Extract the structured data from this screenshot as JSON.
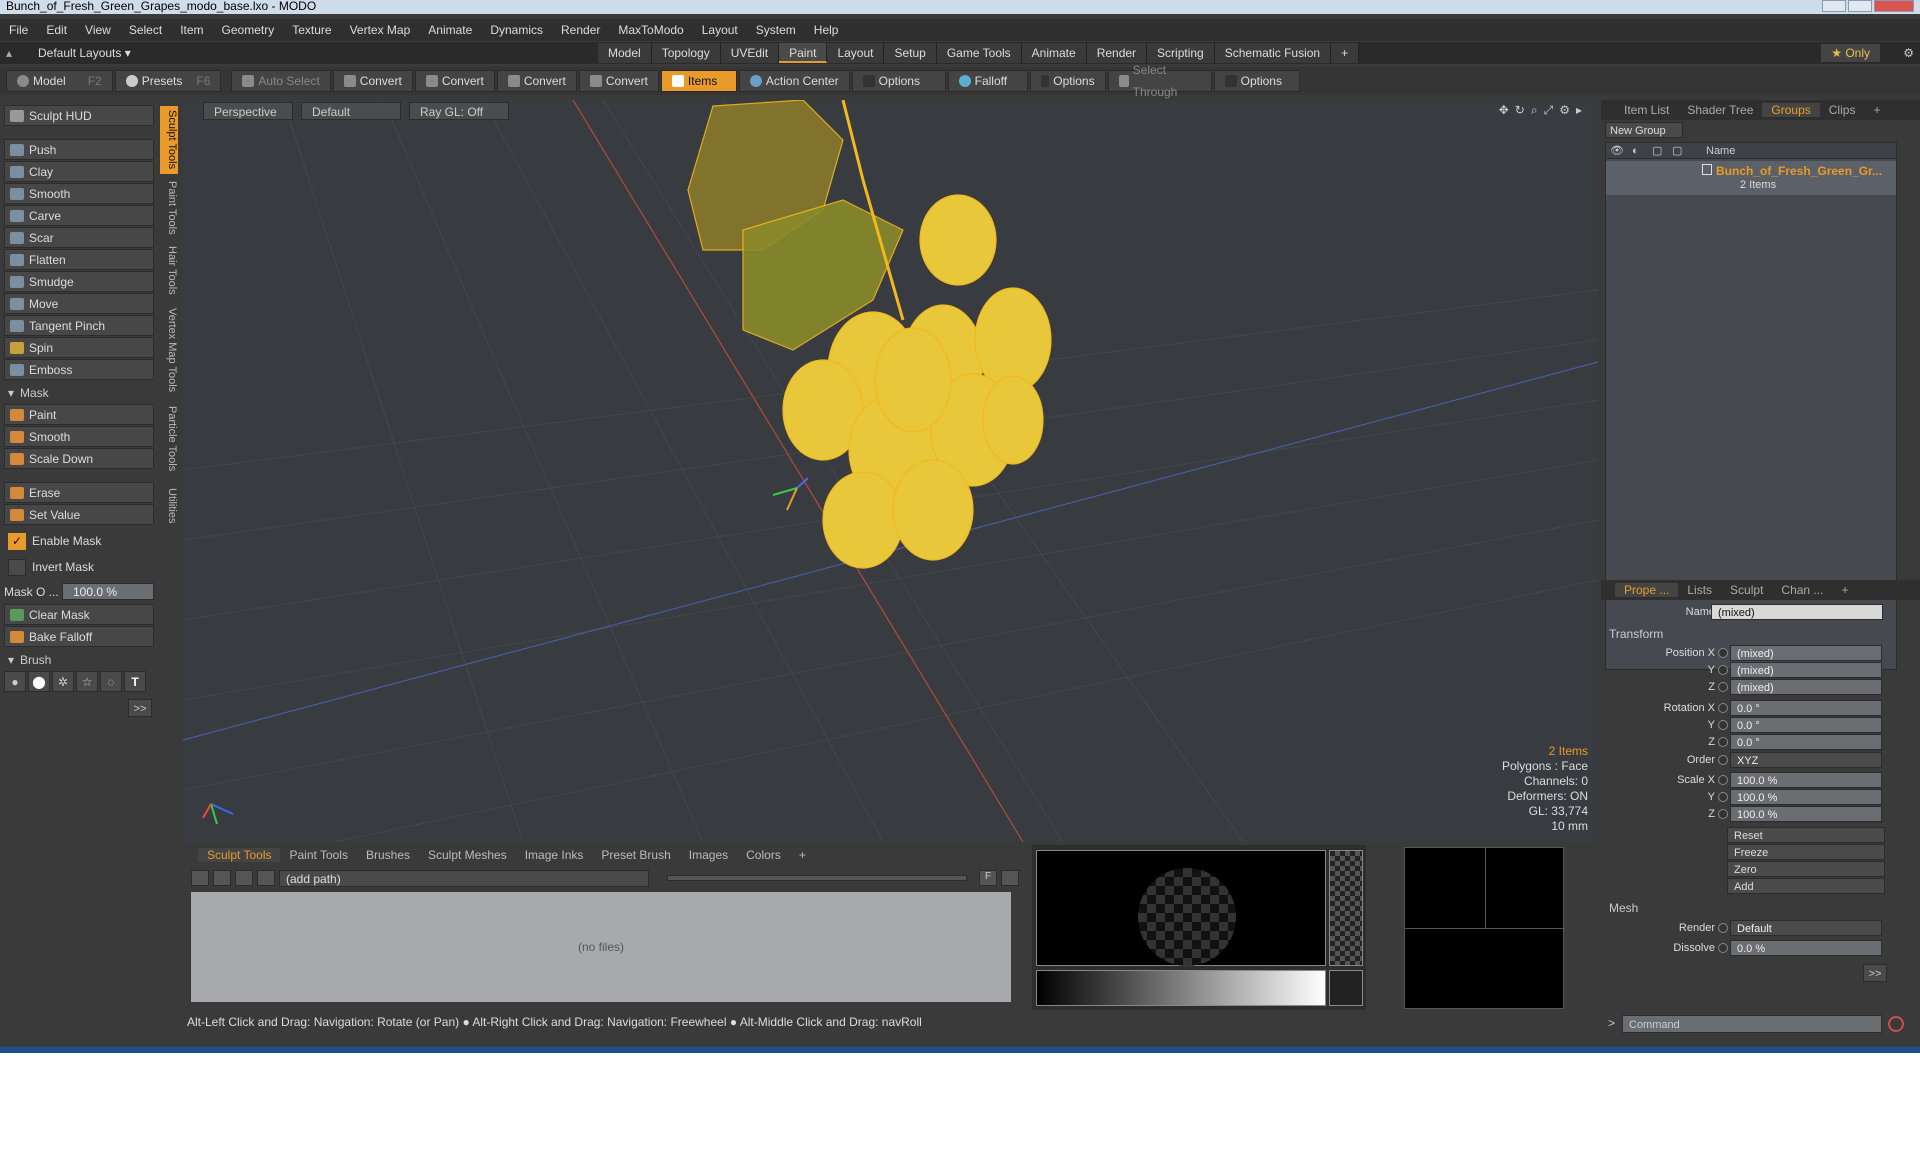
{
  "window": {
    "title": "Bunch_of_Fresh_Green_Grapes_modo_base.lxo - MODO"
  },
  "menu": [
    "File",
    "Edit",
    "View",
    "Select",
    "Item",
    "Geometry",
    "Texture",
    "Vertex Map",
    "Animate",
    "Dynamics",
    "Render",
    "MaxToModo",
    "Layout",
    "System",
    "Help"
  ],
  "layouts": {
    "default_layouts": "Default Layouts ▾",
    "tabs": [
      "Model",
      "Topology",
      "UVEdit",
      "Paint",
      "Layout",
      "Setup",
      "Game Tools",
      "Animate",
      "Render",
      "Scripting",
      "Schematic Fusion",
      "+"
    ],
    "only_label": "★ Only"
  },
  "toolbar": {
    "model": "Model",
    "model_key": "F2",
    "presets": "Presets",
    "presets_key": "F6",
    "auto_select": "Auto Select",
    "convert1": "Convert",
    "convert2": "Convert",
    "convert3": "Convert",
    "convert4": "Convert",
    "items": "Items",
    "action_center": "Action Center",
    "options1": "Options",
    "falloff": "Falloff",
    "options2": "Options",
    "select_through": "Select Through",
    "options3": "Options"
  },
  "sidetabs": [
    "Sculpt Tools",
    "Paint Tools",
    "Hair Tools",
    "Vertex Map Tools",
    "Particle Tools",
    "Utilities"
  ],
  "sculpt": {
    "hud": "Sculpt HUD",
    "tools": [
      "Push",
      "Clay",
      "Smooth",
      "Carve",
      "Scar",
      "Flatten",
      "Smudge",
      "Move",
      "Tangent Pinch",
      "Spin",
      "Emboss"
    ],
    "mask_header": "Mask",
    "mask_tools": [
      "Paint",
      "Smooth",
      "Scale Down"
    ],
    "erase": "Erase",
    "set_value": "Set Value",
    "enable_mask": "Enable Mask",
    "invert_mask": "Invert Mask",
    "mask_opacity_label": "Mask O ...",
    "mask_opacity_value": "100.0 %",
    "clear_mask": "Clear Mask",
    "bake_falloff": "Bake Falloff",
    "brush_header": "Brush"
  },
  "viewport": {
    "view": "Perspective",
    "shading": "Default",
    "raygl": "Ray GL: Off",
    "stats": {
      "items": "2 Items",
      "polygons": "Polygons : Face",
      "channels": "Channels: 0",
      "deformers": "Deformers: ON",
      "gl": "GL: 33,774",
      "scale": "10 mm"
    }
  },
  "bottom": {
    "tabs": [
      "Sculpt Tools",
      "Paint Tools",
      "Brushes",
      "Sculpt Meshes",
      "Image Inks",
      "Preset Brush",
      "Images",
      "Colors",
      "+"
    ],
    "path": "(add path)",
    "empty": "(no files)",
    "f_label": "F"
  },
  "status": "Alt-Left Click and Drag: Navigation: Rotate (or Pan) ● Alt-Right Click and Drag: Navigation: Freewheel ● Alt-Middle Click and Drag: navRoll",
  "right_top": {
    "tabs": [
      "Item List",
      "Shader Tree",
      "Groups",
      "Clips",
      "+"
    ],
    "new_group": "New Group",
    "name_header": "Name",
    "group_name": "Bunch_of_Fresh_Green_Gr...",
    "group_count": "2 Items"
  },
  "properties": {
    "tabs": [
      "Prope ...",
      "Lists",
      "Sculpt",
      "Chan ...",
      "+"
    ],
    "name_label": "Name",
    "name_value": "(mixed)",
    "transform_header": "Transform",
    "pos_x_label": "Position X",
    "pos_x": "(mixed)",
    "pos_y_label": "Y",
    "pos_y": "(mixed)",
    "pos_z_label": "Z",
    "pos_z": "(mixed)",
    "rot_x_label": "Rotation X",
    "rot_x": "0.0 °",
    "rot_y_label": "Y",
    "rot_y": "0.0 °",
    "rot_z_label": "Z",
    "rot_z": "0.0 °",
    "order_label": "Order",
    "order": "XYZ",
    "scale_x_label": "Scale X",
    "scale_x": "100.0 %",
    "scale_y_label": "Y",
    "scale_y": "100.0 %",
    "scale_z_label": "Z",
    "scale_z": "100.0 %",
    "reset": "Reset",
    "freeze": "Freeze",
    "zero": "Zero",
    "add": "Add",
    "mesh_header": "Mesh",
    "render_label": "Render",
    "render": "Default",
    "dissolve_label": "Dissolve",
    "dissolve": "0.0 %",
    "more": ">>"
  },
  "command": {
    "placeholder": "Command"
  },
  "colors": {
    "accent": "#e89b2a",
    "wire": "#f2b81e"
  }
}
